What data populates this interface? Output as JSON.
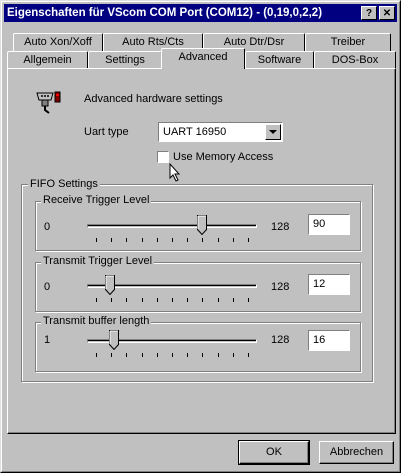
{
  "window": {
    "title": "Eigenschaften für VScom COM Port (COM12) - (0,19,0,2,2)",
    "help_button": "?",
    "close_button": "✕"
  },
  "tabs_row1": [
    "Auto Xon/Xoff",
    "Auto Rts/Cts",
    "Auto Dtr/Dsr",
    "Treiber"
  ],
  "tabs_row2": [
    "Allgemein",
    "Settings",
    "Advanced",
    "Software",
    "DOS-Box"
  ],
  "active_tab": "Advanced",
  "advanced": {
    "heading": "Advanced hardware settings",
    "uart_label": "Uart type",
    "uart_value": "UART 16950",
    "memory_access_label": "Use Memory Access",
    "memory_access_checked": false
  },
  "fifo": {
    "title": "FIFO Settings",
    "receive": {
      "title": "Receive Trigger Level",
      "min": "0",
      "max": "128",
      "value": "90",
      "level": 0.7
    },
    "transmit": {
      "title": "Transmit Trigger Level",
      "min": "0",
      "max": "128",
      "value": "12",
      "level": 0.094
    },
    "buffer": {
      "title": "Transmit buffer length",
      "min": "1",
      "max": "128",
      "value": "16",
      "level": 0.118
    }
  },
  "buttons": {
    "ok": "OK",
    "cancel": "Abbrechen"
  }
}
